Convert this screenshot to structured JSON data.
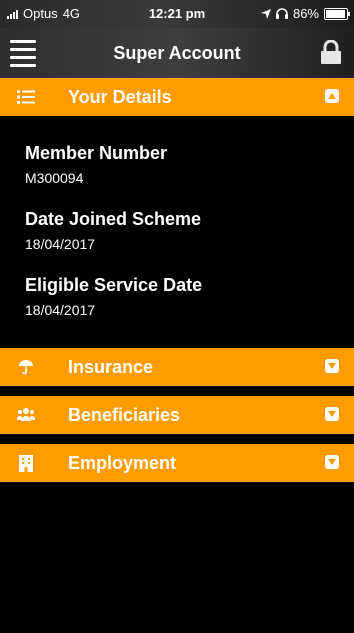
{
  "status_bar": {
    "carrier": "Optus",
    "network": "4G",
    "time": "12:21 pm",
    "battery": "86%",
    "battery_level": 0.86
  },
  "nav": {
    "title": "Super Account"
  },
  "sections": [
    {
      "label": "Your Details",
      "icon": "list-icon",
      "expanded": true
    },
    {
      "label": "Insurance",
      "icon": "umbrella-icon",
      "expanded": false
    },
    {
      "label": "Beneficiaries",
      "icon": "people-icon",
      "expanded": false
    },
    {
      "label": "Employment",
      "icon": "building-icon",
      "expanded": false
    }
  ],
  "details": [
    {
      "title": "Member Number",
      "value": "M300094"
    },
    {
      "title": "Date Joined Scheme",
      "value": "18/04/2017"
    },
    {
      "title": "Eligible Service Date",
      "value": "18/04/2017"
    }
  ],
  "colors": {
    "accent": "#ff9c00",
    "background": "#000000"
  }
}
